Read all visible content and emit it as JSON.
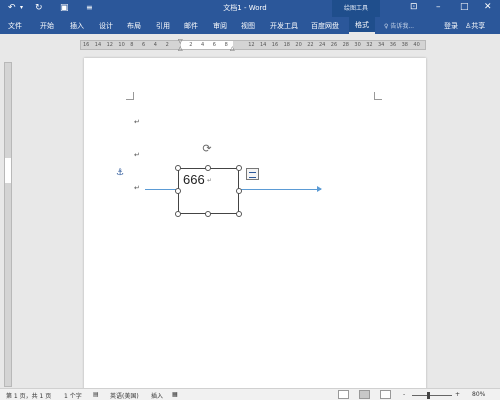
{
  "titlebar": {
    "undo_icon": "undo-icon",
    "redo_icon": "redo-icon",
    "save_icon": "save-icon",
    "customize_icon": "customize-qat-icon",
    "title": "文档1 - Word",
    "drawing_tools": "绘图工具"
  },
  "ribbon": {
    "tabs": [
      "文件",
      "开始",
      "插入",
      "设计",
      "布局",
      "引用",
      "邮件",
      "审阅",
      "视图",
      "开发工具",
      "百度网盘",
      "格式"
    ],
    "active_tab": "格式",
    "search_placeholder": "告诉我...",
    "login": "登录",
    "share": "共享"
  },
  "ruler": {
    "ticks": [
      "16",
      "14",
      "12",
      "10",
      "8",
      "6",
      "4",
      "2",
      "",
      "2",
      "4",
      "6",
      "8",
      "",
      "12",
      "14",
      "16",
      "18",
      "20",
      "22",
      "24",
      "26",
      "28",
      "30",
      "32",
      "34",
      "36",
      "38",
      "40"
    ]
  },
  "document": {
    "textbox_text": "666",
    "paragraph_mark": "↵"
  },
  "statusbar": {
    "page": "第 1 页，共 1 页",
    "words": "1 个字",
    "language": "英语(美国)",
    "mode": "插入",
    "zoom_minus": "-",
    "zoom_plus": "+",
    "zoom": "80%",
    "zoom_level": 0.8
  }
}
